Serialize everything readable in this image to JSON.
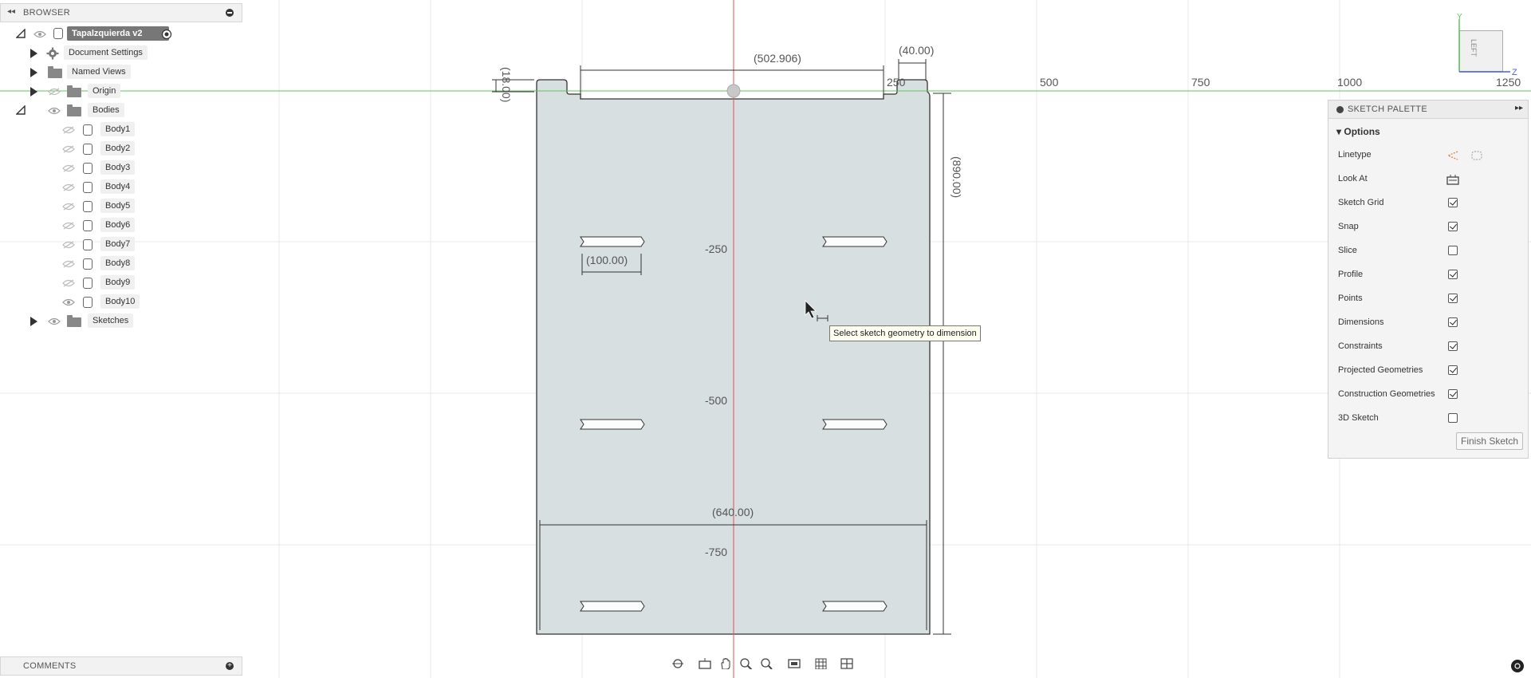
{
  "browser": {
    "title": "BROWSER",
    "root": "Tapalzquierda v2",
    "items": [
      {
        "label": "Document Settings"
      },
      {
        "label": "Named Views"
      },
      {
        "label": "Origin"
      },
      {
        "label": "Bodies"
      }
    ],
    "bodies": [
      "Body1",
      "Body2",
      "Body3",
      "Body4",
      "Body5",
      "Body6",
      "Body7",
      "Body8",
      "Body9",
      "Body10"
    ],
    "sketches": "Sketches"
  },
  "comments": {
    "title": "COMMENTS"
  },
  "canvas": {
    "axis_labels_x": [
      "250",
      "500",
      "750",
      "1000",
      "1250"
    ],
    "axis_labels_y": [
      "-250",
      "-500",
      "-750"
    ],
    "dimensions": {
      "top_width": "(502.906)",
      "tab_width": "(40.00)",
      "tab_height": "(18.00)",
      "height": "(890.00)",
      "slot_width": "(100.00)",
      "bottom_width": "(640.00)"
    },
    "tooltip": "Select sketch geometry to dimension",
    "colors": {
      "sketch_fill": "#d7dfe0",
      "y_axis": "#e05050",
      "x_axis": "#5bc85b",
      "grid": "#e6e6e6"
    }
  },
  "palette": {
    "title": "SKETCH PALETTE",
    "options_title": "Options",
    "rows": [
      {
        "label": "Linetype",
        "kind": "icons"
      },
      {
        "label": "Look At",
        "kind": "icon"
      },
      {
        "label": "Sketch Grid",
        "kind": "check",
        "checked": true
      },
      {
        "label": "Snap",
        "kind": "check",
        "checked": true
      },
      {
        "label": "Slice",
        "kind": "check",
        "checked": false
      },
      {
        "label": "Profile",
        "kind": "check",
        "checked": true
      },
      {
        "label": "Points",
        "kind": "check",
        "checked": true
      },
      {
        "label": "Dimensions",
        "kind": "check",
        "checked": true
      },
      {
        "label": "Constraints",
        "kind": "check",
        "checked": true
      },
      {
        "label": "Projected Geometries",
        "kind": "check",
        "checked": true
      },
      {
        "label": "Construction Geometries",
        "kind": "check",
        "checked": true
      },
      {
        "label": "3D Sketch",
        "kind": "check",
        "checked": false
      }
    ],
    "finish_label": "Finish Sketch"
  },
  "viewcube": {
    "face": "LEFT",
    "axis_y": "Y",
    "axis_z": "Z"
  }
}
